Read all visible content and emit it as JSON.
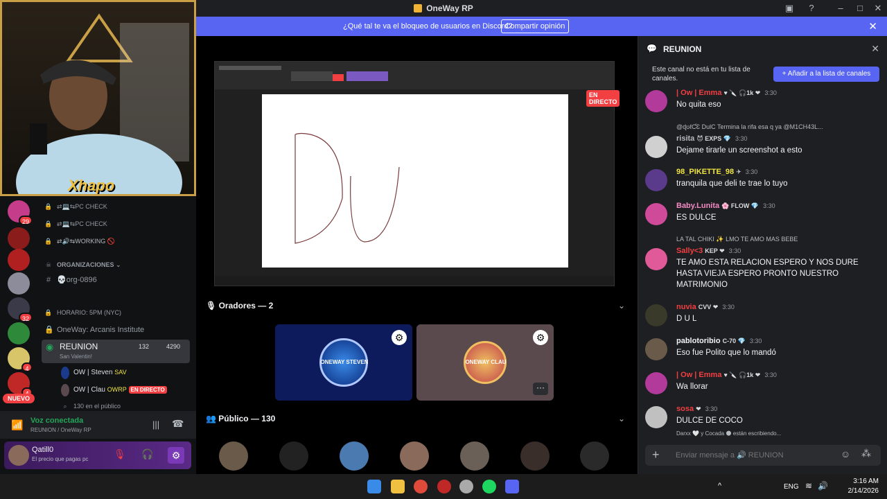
{
  "window": {
    "title": "OneWay RP"
  },
  "banner": {
    "message": "¿Qué tal te va el bloqueo de usuarios en Discord?",
    "button": "Compartir opinión"
  },
  "webcam": {
    "overlay_name": "Xhapo"
  },
  "servers": [
    {
      "badge": "29",
      "color": "#c43c8a"
    },
    {
      "badge": "",
      "color": "#8b1c1c"
    },
    {
      "badge": "",
      "color": "#b02020"
    },
    {
      "badge": "",
      "color": "#8c8c9a"
    },
    {
      "badge": "32",
      "color": "#3a3a48"
    },
    {
      "badge": "",
      "color": "#2e8a3a"
    },
    {
      "badge": "4",
      "color": "#d8c56a"
    },
    {
      "badge": "4",
      "color": "#c02828"
    }
  ],
  "new_badge": "NUEVO",
  "channels": {
    "items": [
      {
        "label": "⇄💻⇆PC CHECK"
      },
      {
        "label": "⇄💻⇆PC CHECK"
      },
      {
        "label": "⇄🔊⇆WORKING 🚫"
      }
    ],
    "category": "ORGANIZACIONES",
    "org_channel": "💀org-0896",
    "horario": "HORARIO: 5PM (NYC)",
    "institute": "OneWay: Arcanis Institute",
    "voice_channel": "REUNION",
    "voice_status": "San Valentin!",
    "voice_count": "132",
    "voice_count2": "4290",
    "voice_users": [
      {
        "name": "OW | Steven",
        "tag": "SAV",
        "live": ""
      },
      {
        "name": "OW | Clau",
        "tag": "OWRP",
        "live": "EN DIRECTO"
      }
    ],
    "audience": "130 en el público"
  },
  "voice_panel": {
    "status": "Voz conectada",
    "location": "REUNION / OneWay RP"
  },
  "user_panel": {
    "name": "Qatill0",
    "status": "El precio que pagas pc"
  },
  "stage": {
    "live_badge": "EN DIRECTO",
    "canvas_text": "DU",
    "speakers_label": "Oradores — 2",
    "audience_label": "Público — 130",
    "speaker_tiles": [
      {
        "name": "ONEWAY STEVEN",
        "color": "#0d1a5c"
      },
      {
        "name": "ONEWAY CLAU",
        "color": "#5a4a4e"
      }
    ],
    "audience_avatars": [
      "#6a5a4a",
      "#222",
      "#4a7ab0",
      "#8a6a5a",
      "#6a6058",
      "#3a2e2a",
      "#2a2a2a"
    ]
  },
  "chat": {
    "channel": "REUNION",
    "notice": "Este canal no está en tu lista de canales.",
    "notice_button": "+ Añadir a la lista de canales",
    "messages": [
      {
        "name": "| Ow | Emma",
        "name_color": "#f23f42",
        "badges": "♥ 🔪 🎧1k ❤",
        "time": "3:30",
        "text": "No quita eso",
        "reply": "",
        "avatar": "#b23a9a"
      },
      {
        "name": "risita",
        "name_color": "#b5bac1",
        "badges": "😈 EXPS 💎",
        "time": "3:30",
        "text": "Dejame tirarle un screenshot a esto",
        "reply": "@ɖʊℓƇƐ DulC Termina la rifa esa q ya @M1CH43L...",
        "avatar": "#d0d0d0"
      },
      {
        "name": "98_PIKETTE_98",
        "name_color": "#f0e442",
        "badges": "✈",
        "time": "3:30",
        "text": "tranquila que deli te trae lo tuyo",
        "reply": "",
        "avatar": "#5a3a8a"
      },
      {
        "name": "Baby.Lunita",
        "name_color": "#f28bc5",
        "badges": "🌸 FLOW 💎",
        "time": "3:30",
        "text": "ES DULCE",
        "reply": "",
        "avatar": "#d04a9a"
      },
      {
        "name": "Sally<3",
        "name_color": "#f23f42",
        "badges": "KEP ❤",
        "time": "3:30",
        "text": "TE AMO ESTA RELACION ESPERO Y NOS DURE HASTA VIEJA ESPERO PRONTO NUESTRO MATRIMONIO",
        "reply": "LA TAL CHIKI ✨ LMO TE AMO MAS BEBE",
        "avatar": "#e05a9a"
      },
      {
        "name": "nuvia",
        "name_color": "#f23f42",
        "badges": "CVV ❤",
        "time": "3:30",
        "text": "D U L",
        "reply": "",
        "avatar": "#3a3a2a"
      },
      {
        "name": "pablotoribio",
        "name_color": "#f2f3f5",
        "badges": "C-70 💎",
        "time": "3:30",
        "text": "Eso fue Polito que lo mandó",
        "reply": "",
        "avatar": "#6a5a4a"
      },
      {
        "name": "| Ow | Emma",
        "name_color": "#f23f42",
        "badges": "♥ 🔪 🎧1k ❤",
        "time": "3:30",
        "text": "Wa llorar",
        "reply": "",
        "avatar": "#b23a9a"
      },
      {
        "name": "sosa",
        "name_color": "#f23f42",
        "badges": "❤",
        "time": "3:30",
        "text": "DULCE DE COCO",
        "reply": "",
        "avatar": "#c0c0c0"
      }
    ],
    "typing": "Darxx 🤍 y Cocada 🌑 están escribiendo...",
    "input_placeholder": "Enviar mensaje a 🔊 REUNION"
  },
  "taskbar": {
    "lang": "ENG",
    "time": "3:16 AM",
    "date": "2/14/2026"
  }
}
